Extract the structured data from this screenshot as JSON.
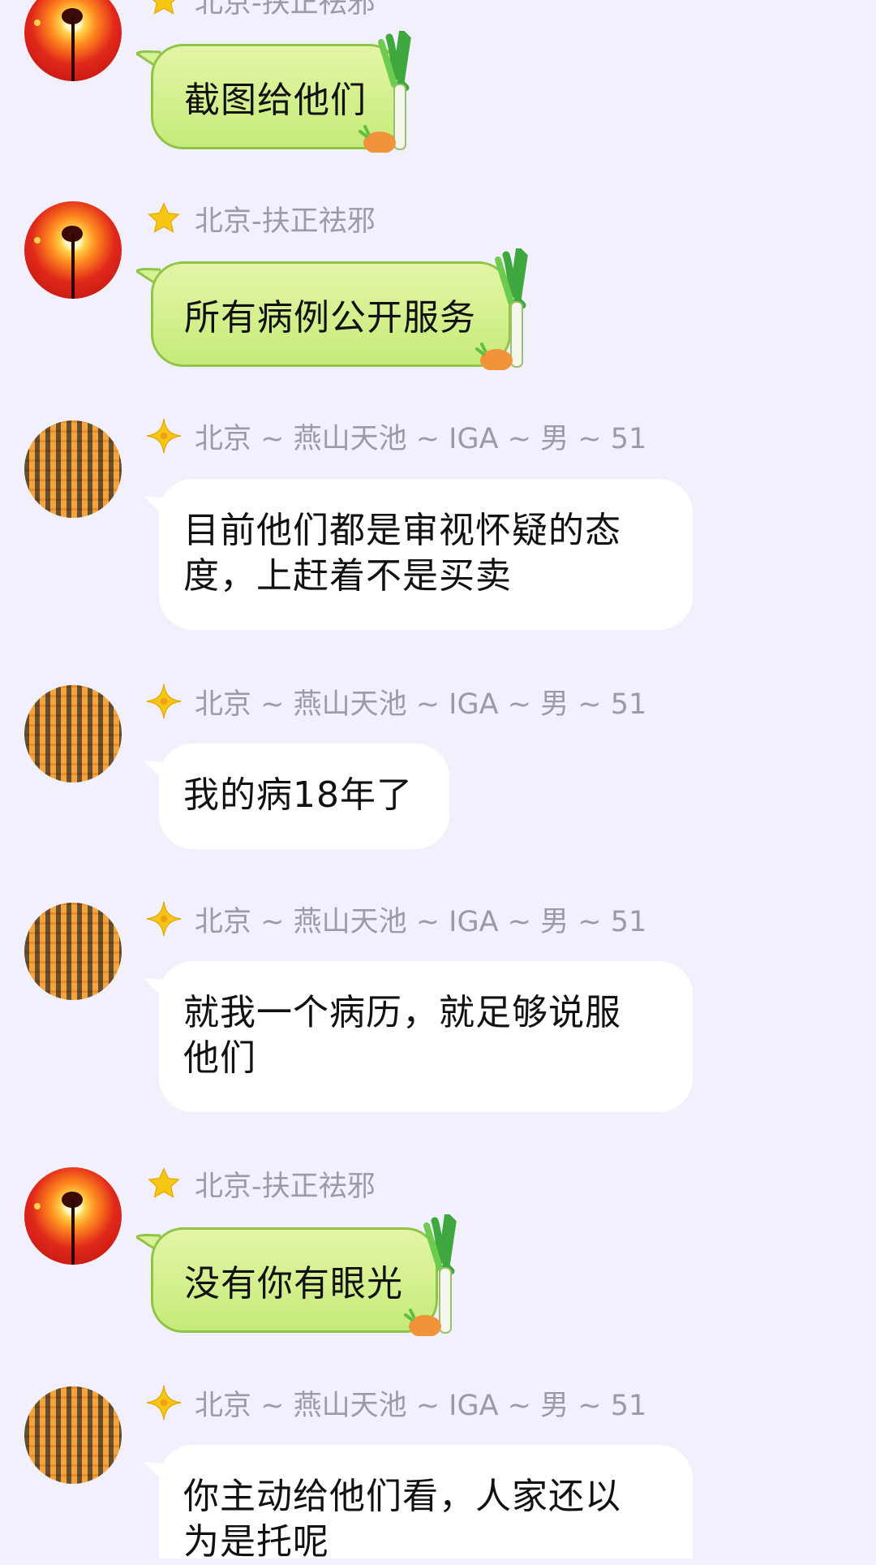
{
  "messages": [
    {
      "sender": "北京-扶正祛邪",
      "text": "截图给他们",
      "style": "green"
    },
    {
      "sender": "北京-扶正祛邪",
      "text": "所有病例公开服务",
      "style": "green"
    },
    {
      "sender": "北京 ~ 燕山天池 ~ IGA ~ 男 ~ 51",
      "lines": [
        "目前他们都是审视怀疑的态",
        "度，上赶着不是买卖"
      ],
      "style": "white"
    },
    {
      "sender": "北京 ~ 燕山天池 ~ IGA ~ 男 ~ 51",
      "lines": [
        "我的病18年了"
      ],
      "style": "white"
    },
    {
      "sender": "北京 ~ 燕山天池 ~ IGA ~ 男 ~ 51",
      "lines": [
        "就我一个病历，就足够说服",
        "他们"
      ],
      "style": "white"
    },
    {
      "sender": "北京-扶正祛邪",
      "text": "没有你有眼光",
      "style": "green"
    },
    {
      "sender": "北京 ~ 燕山天池 ~ IGA ~ 男 ~ 51",
      "lines": [
        "你主动给他们看，人家还以",
        "为是托呢"
      ],
      "style": "white"
    }
  ],
  "colors": {
    "background": "#f3f0fd",
    "green_bubble": "#cbed84",
    "white_bubble": "#ffffff",
    "name_text": "#9a9aa8"
  },
  "icons": {
    "star_badge": "gold-star-icon",
    "diamond_badge": "gold-diamond-icon",
    "sticker": "leek-carrot-sticker"
  }
}
